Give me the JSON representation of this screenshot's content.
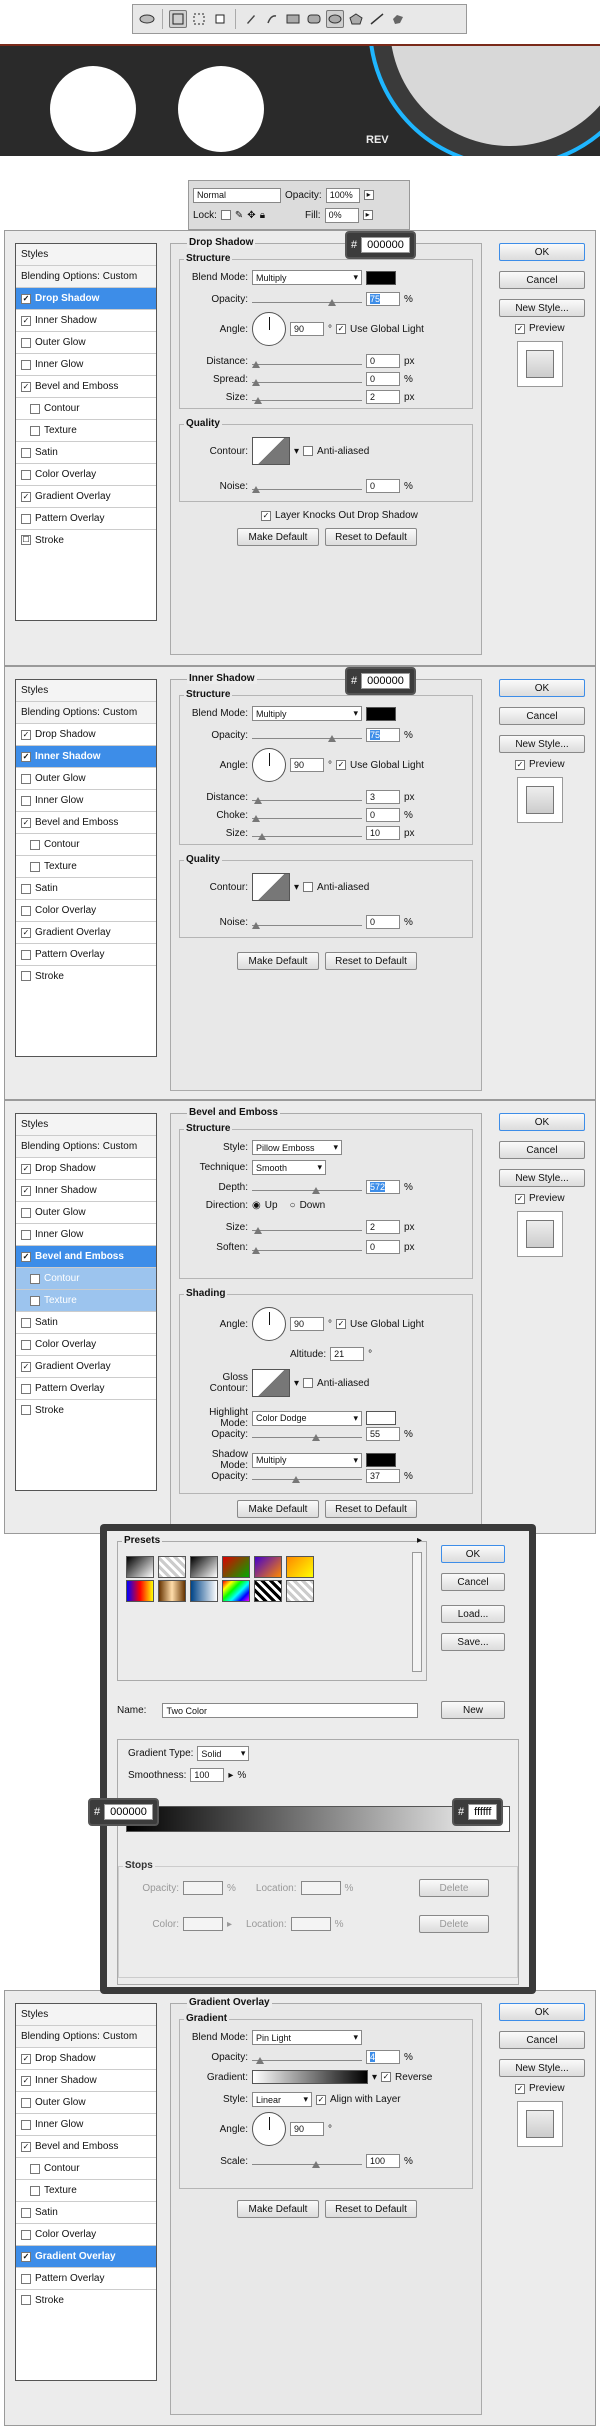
{
  "toolbar": {
    "icons": [
      "ellipse-tool-icon",
      "shape-mode-icon",
      "path-mode-icon",
      "fill-pixels-icon",
      "pen-icon",
      "freeform-pen-icon",
      "rectangle-icon",
      "rounded-rectangle-icon",
      "ellipse-icon",
      "polygon-icon",
      "line-icon",
      "custom-shape-icon"
    ]
  },
  "banner": {
    "label": "REV"
  },
  "layers": {
    "blend_mode": "Normal",
    "opacity_label": "Opacity:",
    "opacity": "100%",
    "lock_label": "Lock:",
    "fill_label": "Fill:",
    "fill": "0%"
  },
  "styles_list": {
    "header": "Styles",
    "blending": "Blending Options: Custom",
    "items": [
      "Drop Shadow",
      "Inner Shadow",
      "Outer Glow",
      "Inner Glow",
      "Bevel and Emboss",
      "Contour",
      "Texture",
      "Satin",
      "Color Overlay",
      "Gradient Overlay",
      "Pattern Overlay",
      "Stroke"
    ]
  },
  "buttons": {
    "ok": "OK",
    "cancel": "Cancel",
    "new_style": "New Style...",
    "preview": "Preview",
    "make_default": "Make Default",
    "reset_default": "Reset to Default"
  },
  "common": {
    "structure": "Structure",
    "quality": "Quality",
    "blend_mode_label": "Blend Mode:",
    "opacity_label": "Opacity:",
    "angle_label": "Angle:",
    "use_global_light": "Use Global Light",
    "distance_label": "Distance:",
    "size_label": "Size:",
    "contour_label": "Contour:",
    "anti_aliased": "Anti-aliased",
    "noise_label": "Noise:",
    "px": "px",
    "pct": "%",
    "deg": "°"
  },
  "drop_shadow": {
    "title": "Drop Shadow",
    "hex_hash": "#",
    "hex": "000000",
    "blend_mode": "Multiply",
    "opacity": "75",
    "angle": "90",
    "distance": "0",
    "spread_label": "Spread:",
    "spread": "0",
    "size": "2",
    "noise": "0",
    "knockout": "Layer Knocks Out Drop Shadow"
  },
  "inner_shadow": {
    "title": "Inner Shadow",
    "hex_hash": "#",
    "hex": "000000",
    "blend_mode": "Multiply",
    "opacity": "75",
    "angle": "90",
    "distance": "3",
    "choke_label": "Choke:",
    "choke": "0",
    "size": "10",
    "noise": "0"
  },
  "bevel": {
    "title": "Bevel and Emboss",
    "style_label": "Style:",
    "style": "Pillow Emboss",
    "technique_label": "Technique:",
    "technique": "Smooth",
    "depth_label": "Depth:",
    "depth": "572",
    "direction_label": "Direction:",
    "up": "Up",
    "down": "Down",
    "size": "2",
    "soften_label": "Soften:",
    "soften": "0",
    "shading": "Shading",
    "angle": "90",
    "altitude_label": "Altitude:",
    "altitude": "21",
    "gloss_label": "Gloss Contour:",
    "highlight_label": "Highlight Mode:",
    "highlight_mode": "Color Dodge",
    "highlight_opacity": "55",
    "shadow_label": "Shadow Mode:",
    "shadow_mode": "Multiply",
    "shadow_opacity": "37"
  },
  "gradient_editor": {
    "presets": "Presets",
    "ok": "OK",
    "cancel": "Cancel",
    "load": "Load...",
    "save": "Save...",
    "name_label": "Name:",
    "name": "Two Color",
    "new": "New",
    "type_label": "Gradient Type:",
    "type": "Solid",
    "smooth_label": "Smoothness:",
    "smooth": "100",
    "left_hex": "000000",
    "right_hex": "ffffff",
    "hash": "#",
    "stops": "Stops",
    "opacity_label": "Opacity:",
    "location_label": "Location:",
    "color_label": "Color:",
    "delete": "Delete"
  },
  "gradient_overlay": {
    "title": "Gradient Overlay",
    "group": "Gradient",
    "blend_mode": "Pin Light",
    "opacity": "4",
    "gradient_label": "Gradient:",
    "reverse": "Reverse",
    "style_label": "Style:",
    "style": "Linear",
    "align": "Align with Layer",
    "angle": "90",
    "scale_label": "Scale:",
    "scale": "100"
  }
}
